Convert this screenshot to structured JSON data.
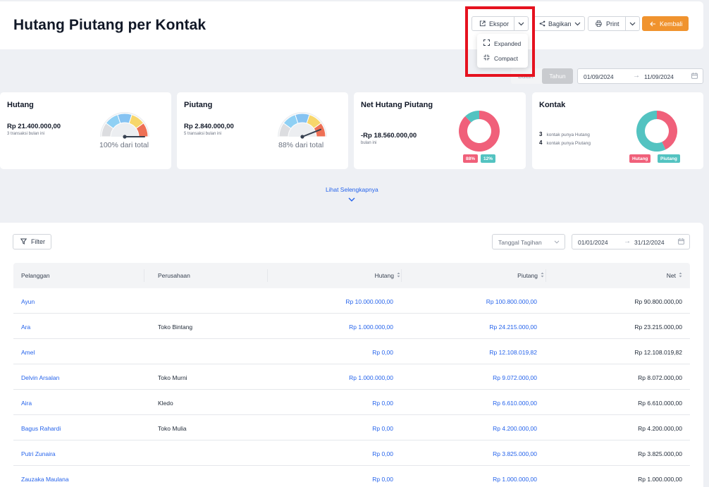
{
  "page_title": "Hutang Piutang per Kontak",
  "toolbar": {
    "ekspor": "Ekspor",
    "bagikan": "Bagikan",
    "print": "Print",
    "kembali": "Kembali"
  },
  "ekspor_menu": {
    "expanded": "Expanded",
    "compact": "Compact"
  },
  "period": {
    "bulan": "Bulan",
    "tahun": "Tahun",
    "active": "Tahun"
  },
  "top_range": {
    "start": "01/09/2024",
    "end": "11/09/2024"
  },
  "cards": {
    "hutang": {
      "title": "Hutang",
      "amount": "Rp 21.400.000,00",
      "sub": "3 transaksi bulan ini",
      "gauge_label": "100% dari total",
      "gauge_value": 1.0
    },
    "piutang": {
      "title": "Piutang",
      "amount": "Rp 2.840.000,00",
      "sub": "5 transaksi bulan ini",
      "gauge_label": "88% dari total",
      "gauge_value": 0.88
    },
    "net": {
      "title": "Net Hutang Piutang",
      "amount": "-Rp 18.560.000,00",
      "sub": "bulan ini",
      "badge_a": "88%",
      "badge_b": "12%",
      "share_a": 0.88
    },
    "kontak": {
      "title": "Kontak",
      "hutang_count": "3",
      "hutang_text": "kontak punya Hutang",
      "piutang_count": "4",
      "piutang_text": "kontak punya Piutang",
      "badge_a": "Hutang",
      "badge_b": "Piutang",
      "share_a": 0.43
    }
  },
  "more_link": "Lihat Selengkapnya",
  "filter": {
    "label": "Filter",
    "select_value": "Tanggal Tagihan",
    "range_start": "01/01/2024",
    "range_end": "31/12/2024"
  },
  "table": {
    "headers": {
      "pelanggan": "Pelanggan",
      "perusahaan": "Perusahaan",
      "hutang": "Hutang",
      "piutang": "Piutang",
      "net": "Net"
    },
    "rows": [
      {
        "pelanggan": "Ayun",
        "perusahaan": "",
        "hutang": "Rp 10.000.000,00",
        "piutang": "Rp 100.800.000,00",
        "net": "Rp 90.800.000,00"
      },
      {
        "pelanggan": "Ara",
        "perusahaan": "Toko Bintang",
        "hutang": "Rp 1.000.000,00",
        "piutang": "Rp 24.215.000,00",
        "net": "Rp 23.215.000,00"
      },
      {
        "pelanggan": "Amel",
        "perusahaan": "",
        "hutang": "Rp 0,00",
        "piutang": "Rp 12.108.019,82",
        "net": "Rp 12.108.019,82"
      },
      {
        "pelanggan": "Delvin Arsalan",
        "perusahaan": "Toko Murni",
        "hutang": "Rp 1.000.000,00",
        "piutang": "Rp 9.072.000,00",
        "net": "Rp 8.072.000,00"
      },
      {
        "pelanggan": "Aira",
        "perusahaan": "Kledo",
        "hutang": "Rp 0,00",
        "piutang": "Rp 6.610.000,00",
        "net": "Rp 6.610.000,00"
      },
      {
        "pelanggan": "Bagus Rahardi",
        "perusahaan": "Toko Mulia",
        "hutang": "Rp 0,00",
        "piutang": "Rp 4.200.000,00",
        "net": "Rp 4.200.000,00"
      },
      {
        "pelanggan": "Putri Zunaira",
        "perusahaan": "",
        "hutang": "Rp 0,00",
        "piutang": "Rp 3.825.000,00",
        "net": "Rp 3.825.000,00"
      },
      {
        "pelanggan": "Zauzaka Maulana",
        "perusahaan": "",
        "hutang": "Rp 0,00",
        "piutang": "Rp 1.000.000,00",
        "net": "Rp 1.000.000,00"
      }
    ]
  },
  "colors": {
    "accent": "#f0932e",
    "link": "#2563eb",
    "donut_red": "#f0607a",
    "donut_teal": "#53c3c1",
    "highlight": "#e5121f"
  }
}
